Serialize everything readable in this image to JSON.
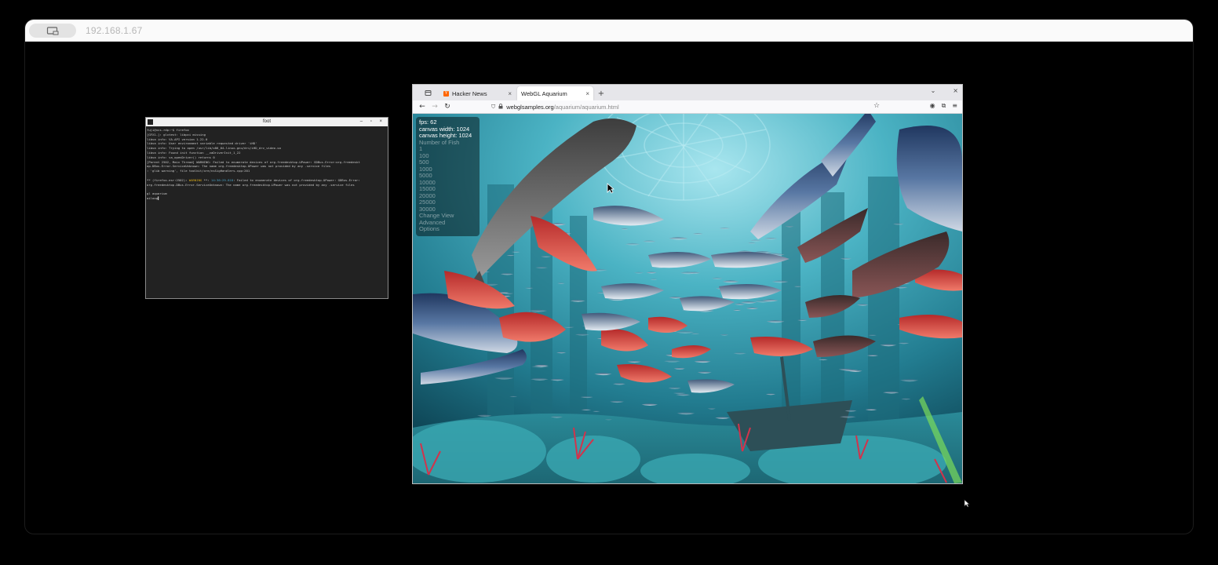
{
  "remote": {
    "address": "192.168.1.67",
    "icon": "remote-desktop-icon"
  },
  "terminal": {
    "title": "foot",
    "controls": "–  ▫  ×",
    "lines": [
      {
        "text": "fuji@ncs-rdp:~$ firefox",
        "cls": ""
      },
      {
        "text": "[GFX1-]: glxtest: libpci missing",
        "cls": ""
      },
      {
        "text": "libva info: VA-API version 1.22.0",
        "cls": ""
      },
      {
        "text": "libva info: User environment variable requested driver 'iHD'",
        "cls": ""
      },
      {
        "text": "libva info: Trying to open /usr/lib/x86_64-linux-gnu/dri/iHD_drv_video.so",
        "cls": ""
      },
      {
        "text": "libva info: Found init function __vaDriverInit_1_22",
        "cls": ""
      },
      {
        "text": "libva info: va_openDriver() returns 0",
        "cls": ""
      },
      {
        "text": "[Parent 2502, Main Thread] WARNING: Failed to enumerate devices of org.freedesktop.UPower: GDBus.Error:org.freedeskt",
        "cls": ""
      },
      {
        "text": "op.DBus.Error.ServiceUnknown: The name org.freedesktop.UPower was not provided by any .service files",
        "cls": ""
      },
      {
        "text": ": 'glib warning', file toolkit/xre/nsSigHandlers.cpp:201",
        "cls": ""
      },
      {
        "text": "",
        "cls": ""
      },
      {
        "text": "** (firefox-esr:2502): WARNING **: 14:36:29.818: Failed to enumerate devices of org.freedesktop.UPower: GDBus.Error:",
        "cls": ""
      },
      {
        "text": "org.freedesktop.DBus.Error.ServiceUnknown: The name org.freedesktop.UPower was not provided by any .service files",
        "cls": ""
      },
      {
        "text": "",
        "cls": ""
      },
      {
        "text": "gl aquarium",
        "cls": ""
      },
      {
        "text": "ailoop▌",
        "cls": ""
      }
    ]
  },
  "browser": {
    "tabs": [
      {
        "label": "Hacker News",
        "favicon": "Y",
        "active": false
      },
      {
        "label": "WebGL Aquarium",
        "favicon": "",
        "active": true
      }
    ],
    "new_tab": "+",
    "url_host": "webglsamples.org",
    "url_path": "/aquarium/aquarium.html",
    "tab_list_icon": "tab-list-icon"
  },
  "hud": {
    "fps": "fps: 62",
    "canvas_width": "canvas width: 1024",
    "canvas_height": "canvas height: 1024",
    "number_of_fish_label": "Number of Fish",
    "fish_options": [
      "1",
      "100",
      "500",
      "1000",
      "5000",
      "10000",
      "15000",
      "20000",
      "25000",
      "30000"
    ],
    "change_view": "Change View",
    "advanced": "Advanced",
    "options": "Options"
  },
  "colors": {
    "water": "#2f8fa3",
    "water_deep": "#0f4f60",
    "tuna": "#3b5a8a",
    "snapper": "#d84a4a"
  }
}
